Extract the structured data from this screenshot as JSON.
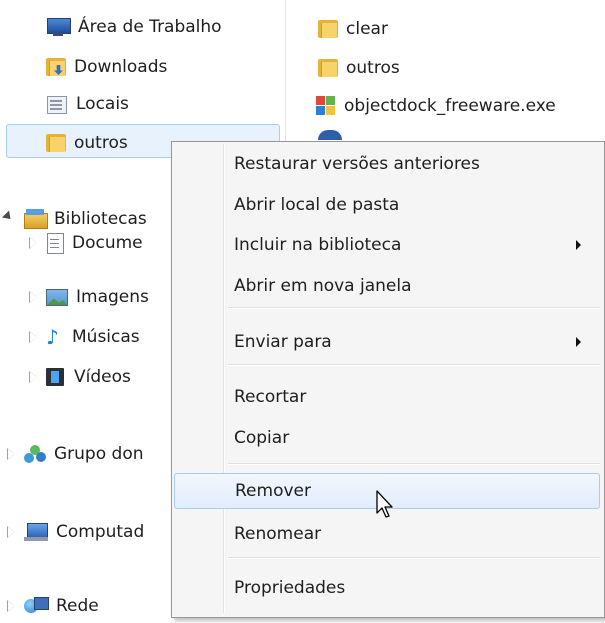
{
  "nav_pane": {
    "items": [
      {
        "label": "Área de Trabalho",
        "icon": "desktop-icon"
      },
      {
        "label": "Downloads",
        "icon": "downloads-folder-icon"
      },
      {
        "label": "Locais",
        "icon": "recent-places-icon"
      },
      {
        "label": "outros",
        "icon": "folder-icon",
        "selected": true
      },
      {
        "label": "Bibliotecas",
        "icon": "libraries-icon",
        "expanded": true
      },
      {
        "label": "Docume",
        "icon": "documents-icon"
      },
      {
        "label": "Imagens",
        "icon": "pictures-icon"
      },
      {
        "label": "Músicas",
        "icon": "music-icon"
      },
      {
        "label": "Vídeos",
        "icon": "videos-icon"
      },
      {
        "label": "Grupo don",
        "icon": "homegroup-icon"
      },
      {
        "label": "Computad",
        "icon": "computer-icon"
      },
      {
        "label": "Rede",
        "icon": "network-icon"
      }
    ]
  },
  "file_list": {
    "items": [
      {
        "label": "clear",
        "icon": "folder-icon"
      },
      {
        "label": "outros",
        "icon": "folder-icon"
      },
      {
        "label": "objectdock_freeware.exe",
        "icon": "exe-icon"
      }
    ]
  },
  "context_menu": {
    "items": [
      {
        "label": "Restaurar versões anteriores"
      },
      {
        "label": "Abrir local de pasta"
      },
      {
        "label": "Incluir na biblioteca",
        "submenu": true
      },
      {
        "label": "Abrir em nova janela"
      },
      {
        "label": "Enviar para",
        "submenu": true
      },
      {
        "label": "Recortar"
      },
      {
        "label": "Copiar"
      },
      {
        "label": "Remover",
        "hovered": true
      },
      {
        "label": "Renomear"
      },
      {
        "label": "Propriedades"
      }
    ]
  },
  "colors": {
    "selection": "#e8f2fd",
    "selection_border": "#a9cdf2",
    "menu_background": "#f5f5f5",
    "menu_border": "#979797"
  }
}
